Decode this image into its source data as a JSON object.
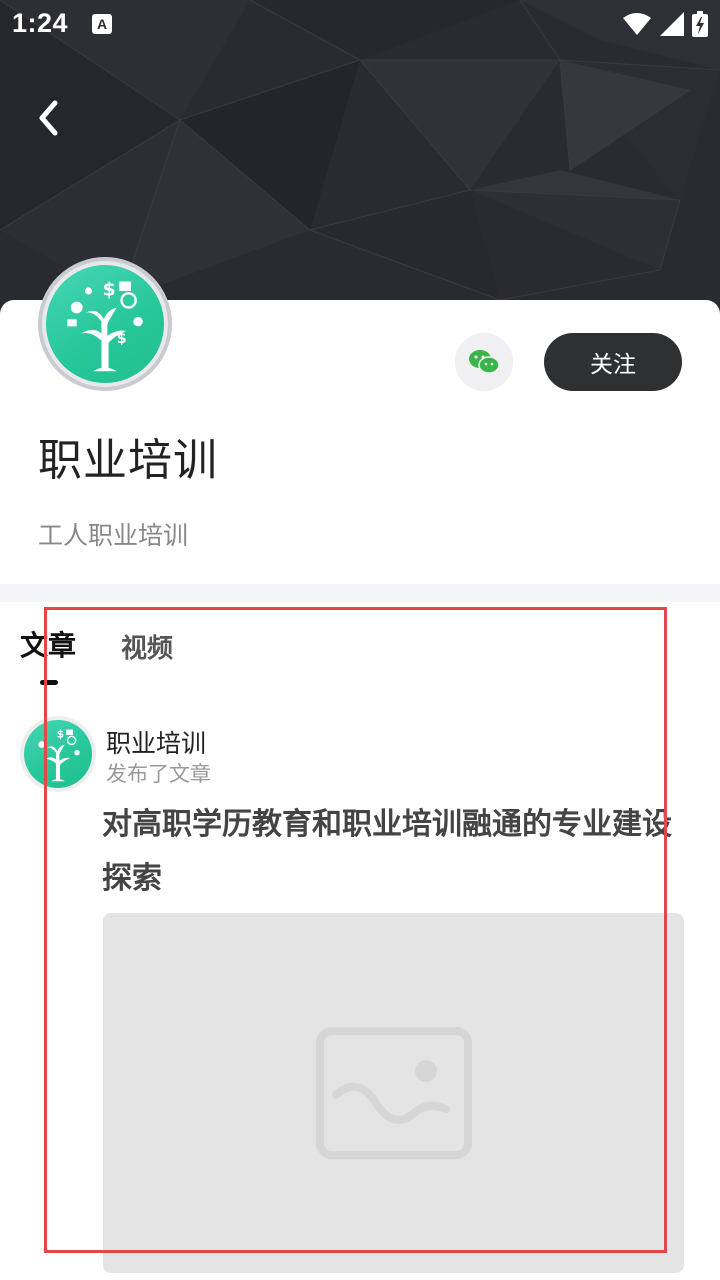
{
  "status_bar": {
    "time": "1:24",
    "notification_icon": "A"
  },
  "header": {
    "back_icon": "chevron-left-icon"
  },
  "profile": {
    "name": "职业培训",
    "description": "工人职业培训",
    "follow_label": "关注",
    "share_icon": "wechat-icon"
  },
  "tabs": [
    {
      "label": "文章",
      "active": true
    },
    {
      "label": "视频",
      "active": false
    }
  ],
  "post": {
    "author": "职业培训",
    "action": "发布了文章",
    "title": "对高职学历教育和职业培训融通的专业建设探索",
    "image_icon": "image-placeholder-icon"
  },
  "colors": {
    "header_bg": "#2b2c31",
    "follow_bg": "#2f3032",
    "avatar_green": "#28c79b",
    "highlight": "#e2474a"
  }
}
